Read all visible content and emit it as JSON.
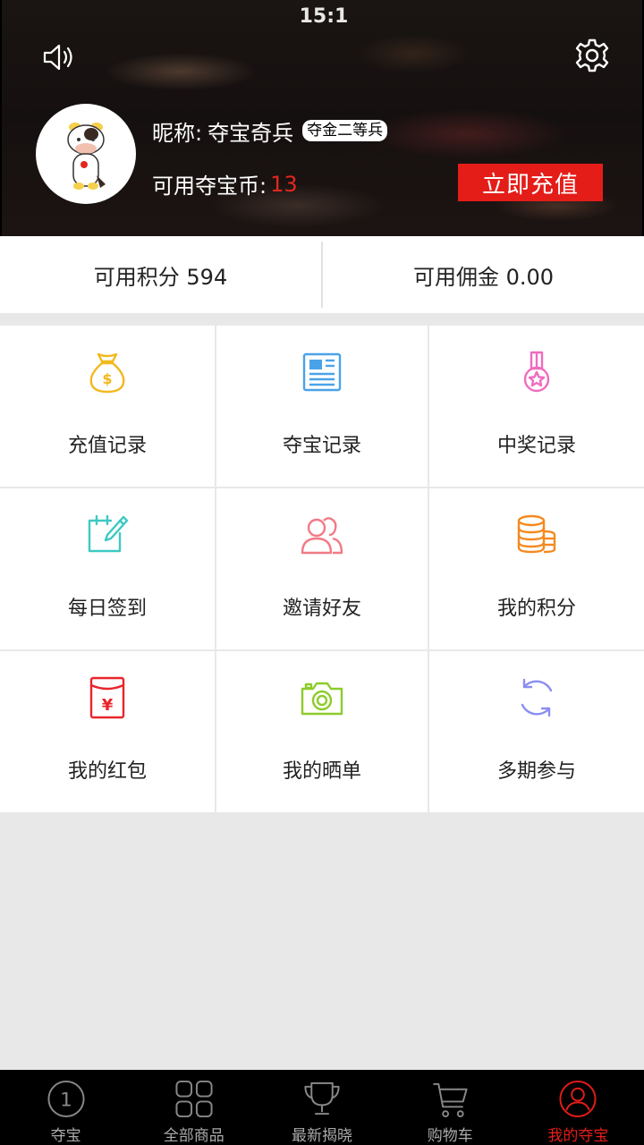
{
  "status": {
    "time": "15:1"
  },
  "header": {
    "nickname_label": "昵称:",
    "nickname": "夺宝奇兵",
    "rank": "夺金二等兵",
    "coins_label": "可用夺宝币:",
    "coins_value": "13",
    "recharge_button": "立即充值",
    "icons": {
      "sound": "speaker-icon",
      "settings": "gear-icon"
    }
  },
  "balances": {
    "points": "可用积分 594",
    "commission": "可用佣金 0.00"
  },
  "menu": [
    {
      "label": "充值记录",
      "icon": "money-bag-icon",
      "color": "#f2b81e"
    },
    {
      "label": "夺宝记录",
      "icon": "newspaper-icon",
      "color": "#4aa3e8"
    },
    {
      "label": "中奖记录",
      "icon": "medal-icon",
      "color": "#f06bc0"
    },
    {
      "label": "每日签到",
      "icon": "calendar-pencil-icon",
      "color": "#3ec9c4"
    },
    {
      "label": "邀请好友",
      "icon": "friends-icon",
      "color": "#f27a86"
    },
    {
      "label": "我的积分",
      "icon": "coin-stack-icon",
      "color": "#f5891f"
    },
    {
      "label": "我的红包",
      "icon": "red-envelope-icon",
      "color": "#e8252b"
    },
    {
      "label": "我的晒单",
      "icon": "camera-icon",
      "color": "#8ccc2a"
    },
    {
      "label": "多期参与",
      "icon": "refresh-icon",
      "color": "#8b8ef0"
    }
  ],
  "tabs": [
    {
      "label": "夺宝",
      "icon": "number-one-icon",
      "active": false
    },
    {
      "label": "全部商品",
      "icon": "grid-icon",
      "active": false
    },
    {
      "label": "最新揭晓",
      "icon": "trophy-icon",
      "active": false
    },
    {
      "label": "购物车",
      "icon": "cart-icon",
      "active": false
    },
    {
      "label": "我的夺宝",
      "icon": "user-icon",
      "active": true
    }
  ],
  "colors": {
    "accent": "#e41d19",
    "background": "#e8e8e8"
  }
}
